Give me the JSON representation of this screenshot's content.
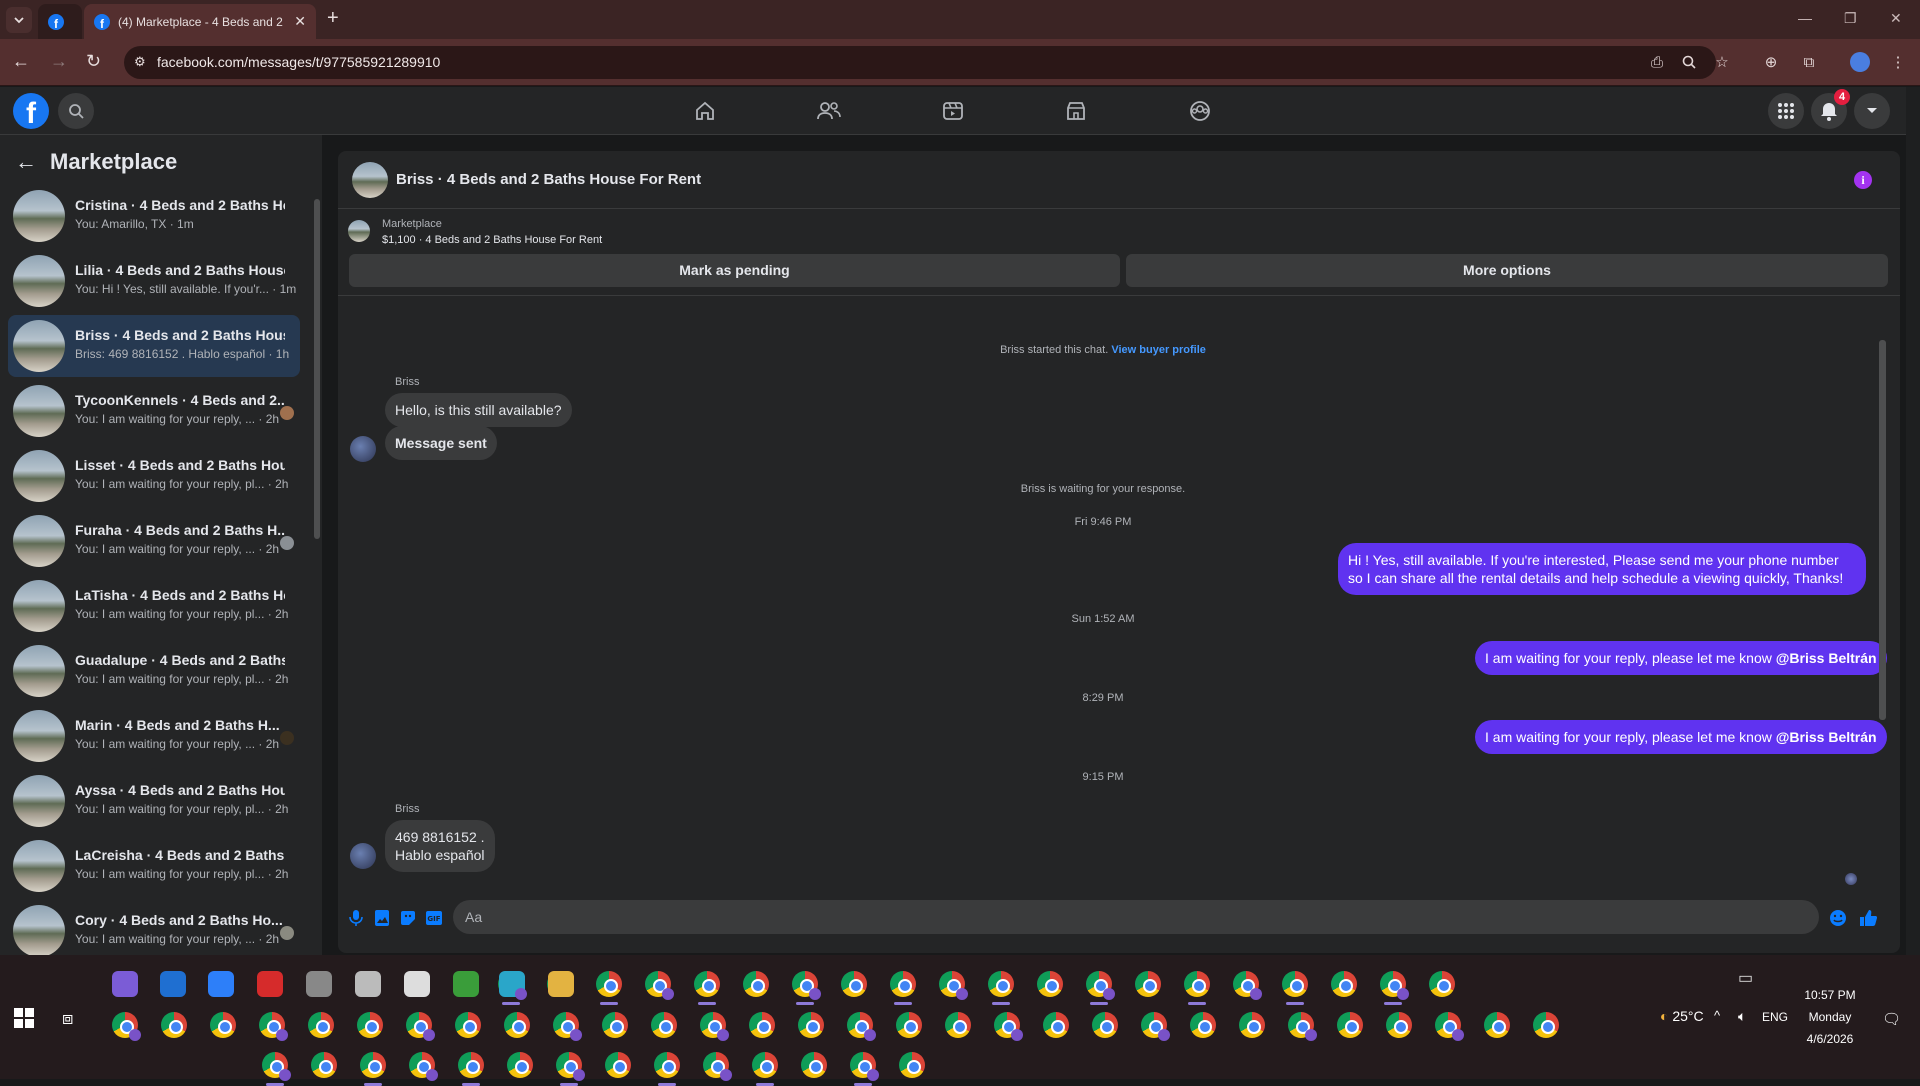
{
  "browser": {
    "tab_title": "(4) Marketplace - 4 Beds and 2",
    "url": "facebook.com/messages/t/977585921289910",
    "new_tab": "+",
    "close_tab": "✕"
  },
  "fb_nav": {
    "notification_count": "4",
    "logo_letter": "f"
  },
  "sidebar": {
    "title": "Marketplace",
    "conversations": [
      {
        "name": "Cristina · 4 Beds and 2 Baths Ho...",
        "snippet": "You: Amarillo, TX · 1m"
      },
      {
        "name": "Lilia · 4 Beds and 2 Baths House...",
        "snippet": "You: Hi ! Yes, still available. If you'r... · 1m"
      },
      {
        "name": "Briss · 4 Beds and 2 Baths Hous...",
        "snippet": "Briss: 469 8816152 . Hablo español · 1h"
      },
      {
        "name": "TycoonKennels · 4 Beds and 2...",
        "snippet": "You: I am waiting for your reply, ... · 2h"
      },
      {
        "name": "Lisset · 4 Beds and 2 Baths Hous...",
        "snippet": "You: I am waiting for your reply, pl... · 2h"
      },
      {
        "name": "Furaha · 4 Beds and 2 Baths H...",
        "snippet": "You: I am waiting for your reply, ... · 2h"
      },
      {
        "name": "LaTisha · 4 Beds and 2 Baths Ho...",
        "snippet": "You: I am waiting for your reply, pl... · 2h"
      },
      {
        "name": "Guadalupe · 4 Beds and 2 Baths ...",
        "snippet": "You: I am waiting for your reply, pl... · 2h"
      },
      {
        "name": "Marin · 4 Beds and 2 Baths H...",
        "snippet": "You: I am waiting for your reply, ... · 2h"
      },
      {
        "name": "Ayssa · 4 Beds and 2 Baths Hous...",
        "snippet": "You: I am waiting for your reply, pl... · 2h"
      },
      {
        "name": "LaCreisha · 4 Beds and 2 Baths ...",
        "snippet": "You: I am waiting for your reply, pl... · 2h"
      },
      {
        "name": "Cory · 4 Beds and 2 Baths Ho...",
        "snippet": "You: I am waiting for your reply, ... · 2h"
      }
    ]
  },
  "chat": {
    "title": "Briss · 4 Beds and 2 Baths House For Rent",
    "info_icon": "i",
    "listing_label": "Marketplace",
    "listing_price": "$1,100 · 4 Beds and 2 Baths House For Rent",
    "mark_pending": "Mark as pending",
    "more_options": "More options",
    "started_text": "Briss started this chat.",
    "view_profile": "View buyer profile",
    "sender_name_1": "Briss",
    "msg_in_1": "Hello, is this still available?",
    "msg_in_2": "Message sent",
    "waiting_text": "Briss is waiting for your response.",
    "time_1": "Fri 9:46 PM",
    "msg_out_1": "Hi ! Yes, still available. If you're interested, Please send me your phone number so I can share all the rental details and help schedule a viewing quickly, Thanks!",
    "time_2": "Sun 1:52 AM",
    "msg_out_2_text": "I am waiting for your reply, please let me know ",
    "msg_out_2_mention": "@Briss Beltrán",
    "time_3": "8:29 PM",
    "msg_out_3_text": "I am waiting for your reply, please let me know ",
    "msg_out_3_mention": "@Briss Beltrán",
    "time_4": "9:15 PM",
    "sender_name_2": "Briss",
    "msg_in_3_line1": "469 8816152 .",
    "msg_in_3_line2": "Hablo español",
    "input_placeholder": "Aa"
  },
  "taskbar": {
    "temperature": "25°C",
    "language": "ENG",
    "time": "10:57 PM",
    "day": "Monday",
    "date": "4/6/2026"
  },
  "colors": {
    "accent_outgoing": "#6033f0",
    "fb_blue": "#1877f2",
    "link": "#4599ff"
  }
}
